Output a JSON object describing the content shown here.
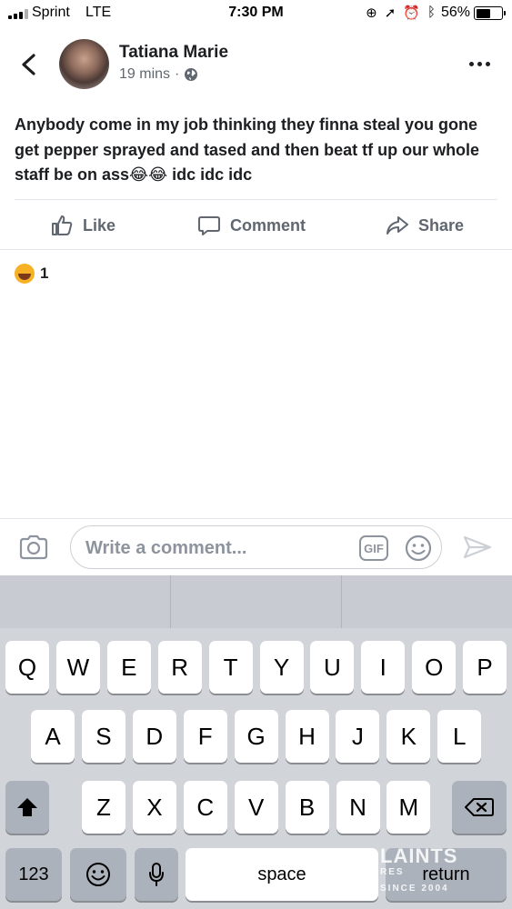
{
  "status_bar": {
    "carrier": "Sprint",
    "network": "LTE",
    "time": "7:30 PM",
    "battery": "56%",
    "battery_level": 0.56,
    "icons": [
      "orientation-lock-icon",
      "location-arrow-icon",
      "alarm-icon",
      "bluetooth-icon"
    ]
  },
  "post": {
    "author": "Tatiana Marie",
    "time": "19 mins",
    "separator": "·",
    "privacy_icon": "globe-icon",
    "body": "Anybody come in my job thinking they finna steal you gone get pepper sprayed and tased and then beat tf up our whole staff be on ass😂😂 idc idc idc",
    "reaction_count": "1",
    "reaction_icon": "haha-emoji-icon"
  },
  "actions": {
    "like": "Like",
    "comment": "Comment",
    "share": "Share"
  },
  "comment_bar": {
    "placeholder": "Write a comment...",
    "gif_label": "GIF"
  },
  "keyboard": {
    "row1": [
      "Q",
      "W",
      "E",
      "R",
      "T",
      "Y",
      "U",
      "I",
      "O",
      "P"
    ],
    "row2": [
      "A",
      "S",
      "D",
      "F",
      "G",
      "H",
      "J",
      "K",
      "L"
    ],
    "row3": [
      "Z",
      "X",
      "C",
      "V",
      "B",
      "N",
      "M"
    ],
    "numbers": "123",
    "space": "space",
    "return": "return"
  },
  "watermark": {
    "text": "LAINTS",
    "sub1": "RES",
    "sub2": "SINCE 2004"
  }
}
